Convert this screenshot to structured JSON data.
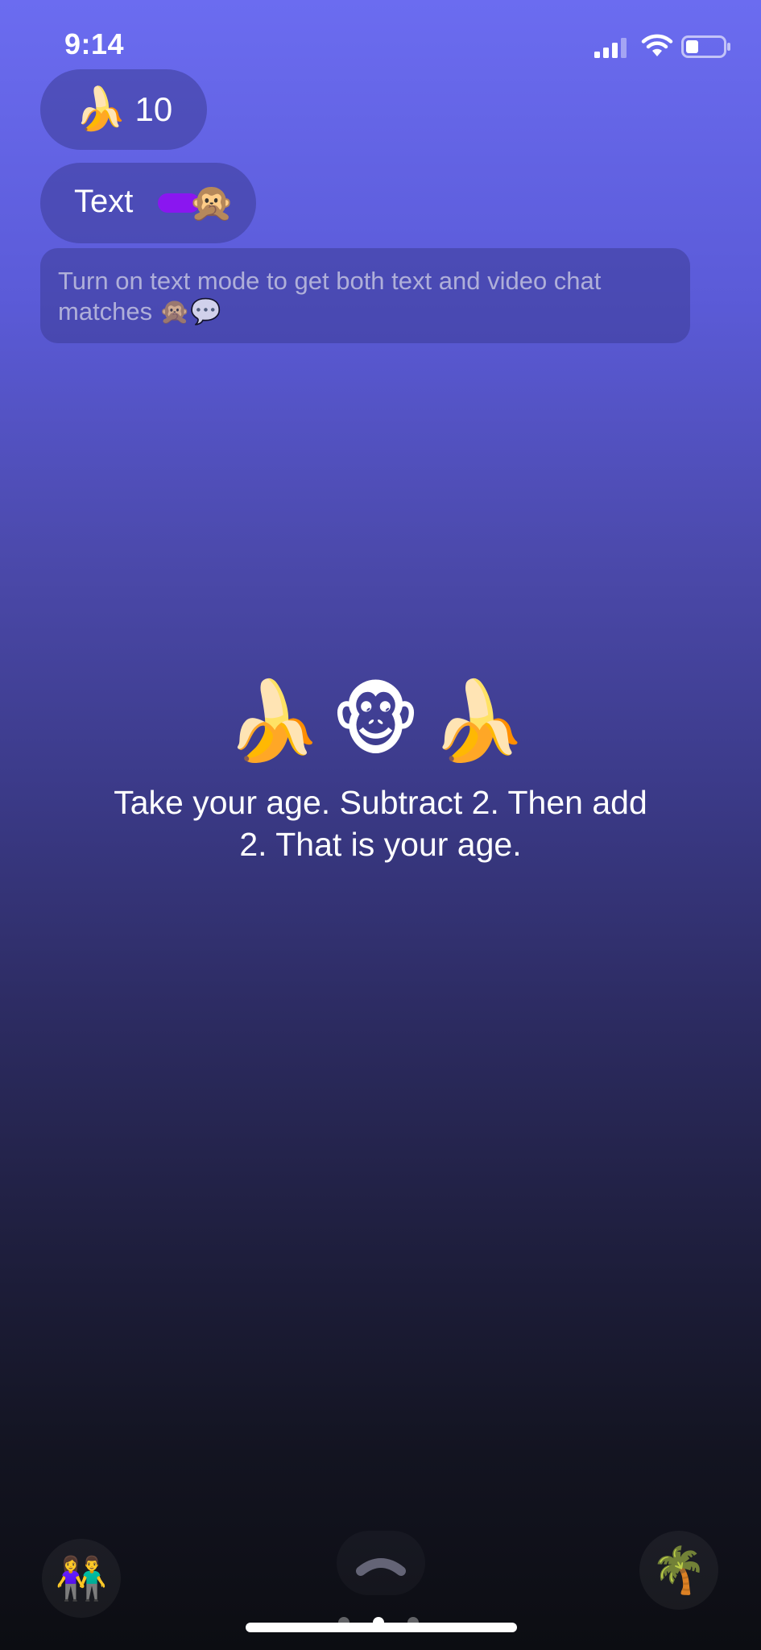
{
  "status_bar": {
    "time": "9:14"
  },
  "banana_counter": {
    "emoji": "🍌",
    "count": "10"
  },
  "text_mode": {
    "label": "Text",
    "toggle_knob_emoji": "🙊",
    "toggle_color": "#8a16f0",
    "enabled": true
  },
  "hint": {
    "text": "Turn on text mode to get both text and video chat matches 🙊💬"
  },
  "center": {
    "emoji_row": "🍌🐵🍌",
    "message": "Take your age. Subtract 2. Then add 2. That is your age."
  },
  "bottom_bar": {
    "left_icon": "👫",
    "right_icon": "🌴",
    "center_icon": "chevron-up-icon",
    "active_page": 2,
    "page_count": 3
  }
}
